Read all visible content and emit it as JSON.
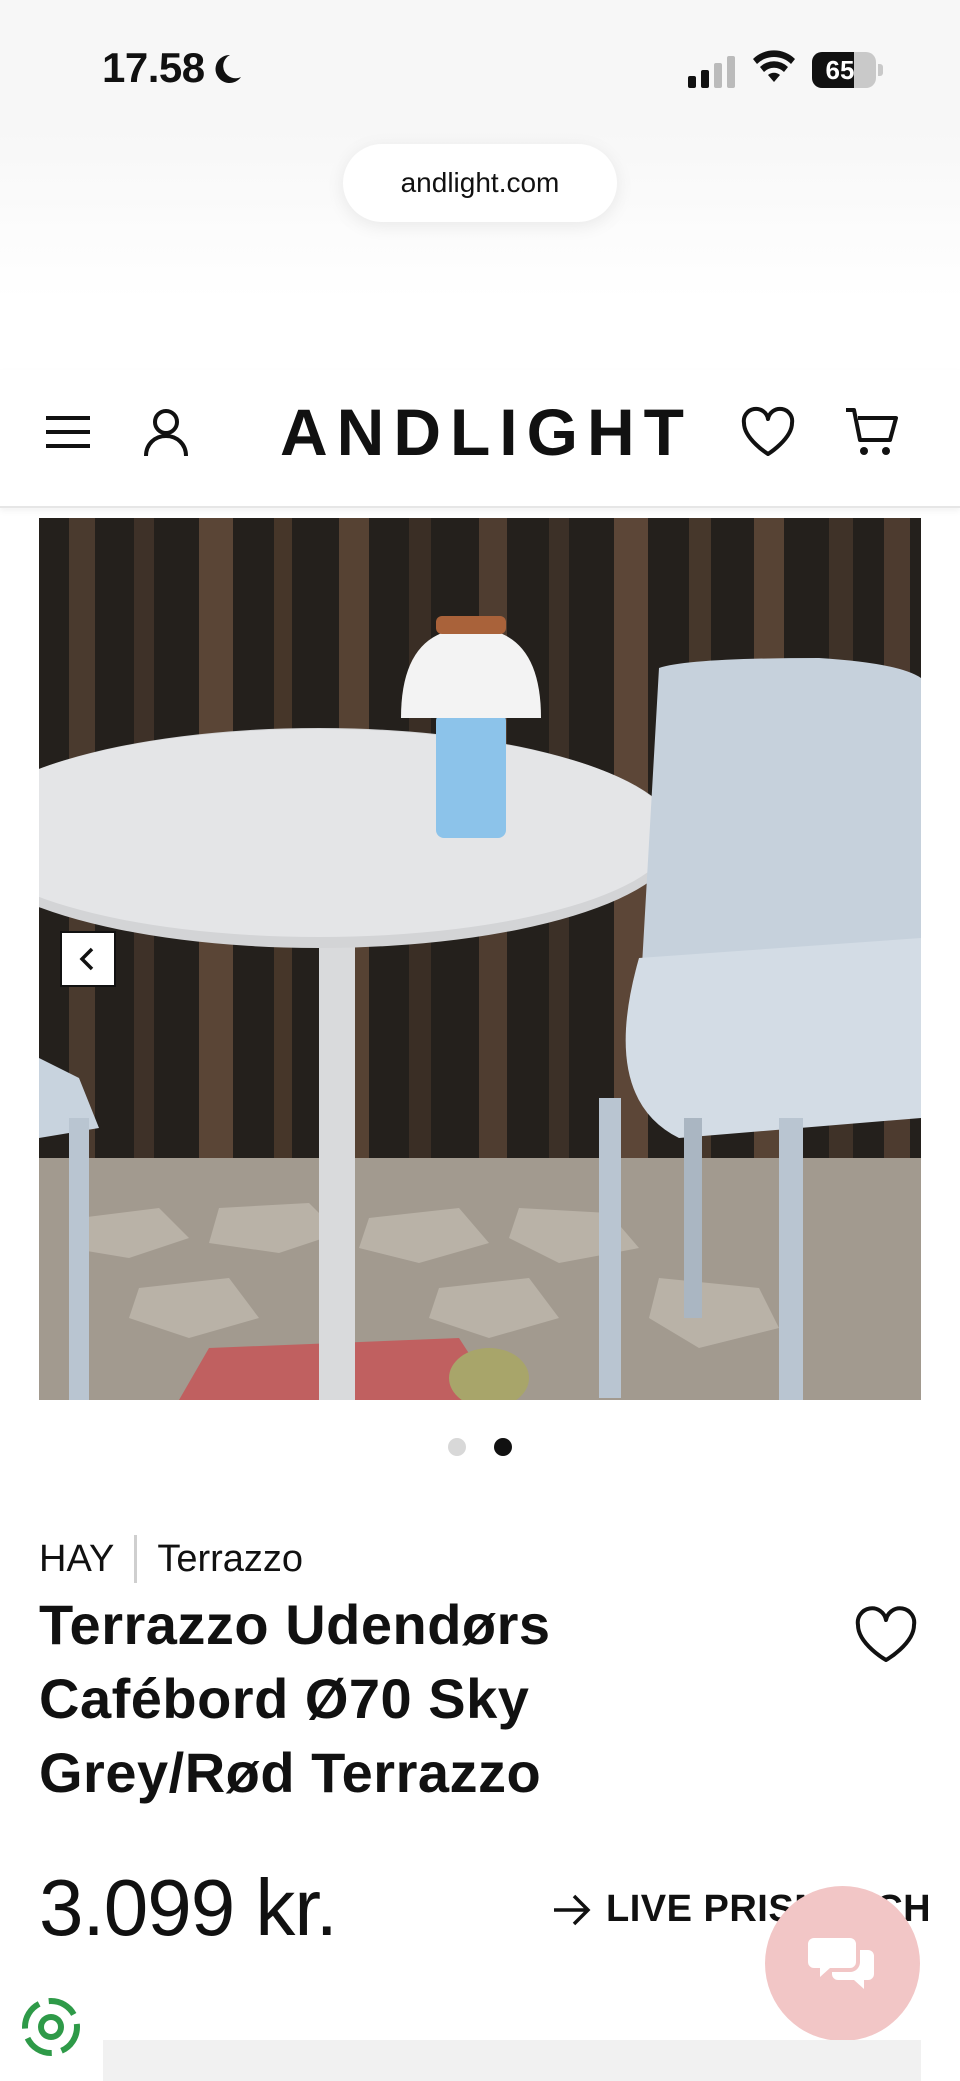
{
  "status_bar": {
    "time": "17.58",
    "battery": "65",
    "battery_level": 0.65
  },
  "browser": {
    "url": "andlight.com"
  },
  "header": {
    "logo": "ANDLIGHT",
    "icons": [
      "menu-icon",
      "account-icon",
      "heart-icon",
      "cart-icon"
    ]
  },
  "gallery": {
    "image_alt": "Terrazzo Udendørs Cafébord",
    "slide_count": 2,
    "active_slide": 2
  },
  "product": {
    "brand": "HAY",
    "series": "Terrazzo",
    "title": "Terrazzo Udendørs Cafébord Ø70 Sky Grey/Rød Terrazzo",
    "price": "3.099 kr.",
    "live_link": "LIVE PRISMATCH"
  },
  "colors": {
    "accent_chat": "#f2c6c6",
    "text": "#111111"
  }
}
